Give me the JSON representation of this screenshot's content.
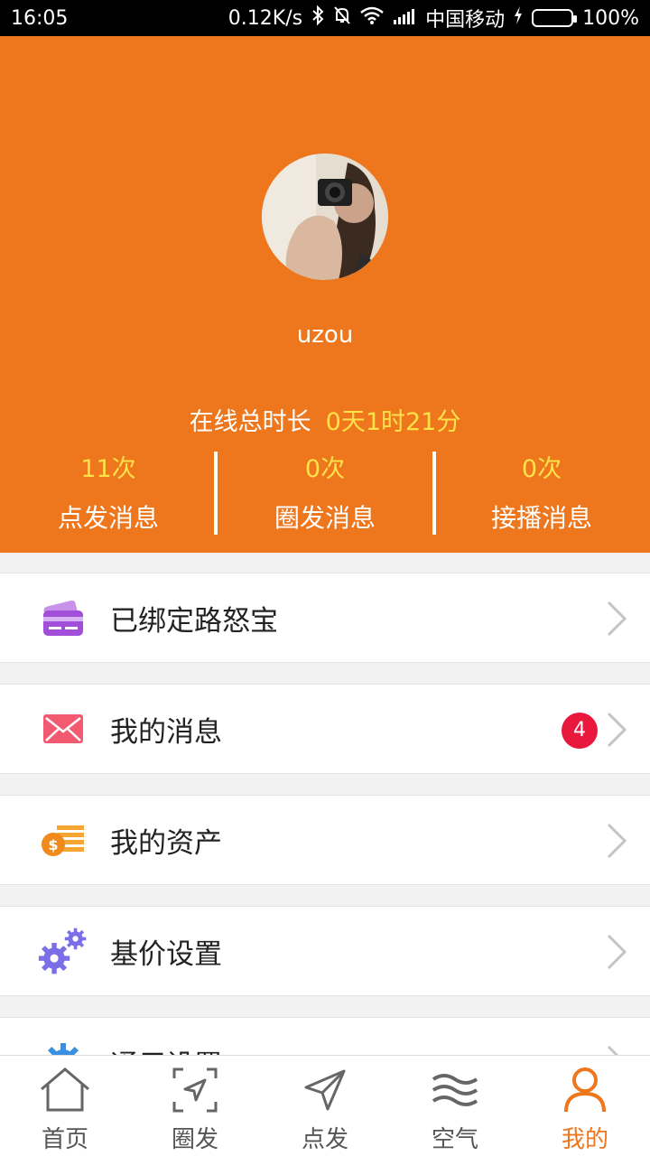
{
  "status_bar": {
    "time": "16:05",
    "speed": "0.12K/s",
    "carrier": "中国移动",
    "battery": "100%",
    "icons": [
      "bluetooth-icon",
      "mute-icon",
      "wifi-icon",
      "signal-icon",
      "charging-icon",
      "battery-icon"
    ]
  },
  "profile": {
    "username": "uzou",
    "online_label": "在线总时长",
    "online_value": "0天1时21分",
    "stats": [
      {
        "count": "11次",
        "label": "点发消息"
      },
      {
        "count": "0次",
        "label": "圈发消息"
      },
      {
        "count": "0次",
        "label": "接播消息"
      }
    ]
  },
  "menu": [
    {
      "label": "已绑定路怒宝",
      "icon": "card-icon"
    },
    {
      "label": "我的消息",
      "icon": "mail-icon",
      "badge": "4"
    },
    {
      "label": "我的资产",
      "icon": "coins-icon"
    },
    {
      "label": "基价设置",
      "icon": "gears-icon"
    },
    {
      "label": "通用设置",
      "icon": "settings-icon"
    }
  ],
  "nav": [
    {
      "label": "首页",
      "icon": "home-icon"
    },
    {
      "label": "圈发",
      "icon": "circle-send-icon"
    },
    {
      "label": "点发",
      "icon": "send-icon"
    },
    {
      "label": "空气",
      "icon": "air-icon"
    },
    {
      "label": "我的",
      "icon": "user-icon",
      "active": true
    }
  ],
  "colors": {
    "accent": "#ee761c",
    "highlight": "#ffe14a",
    "badge": "#e8193c"
  }
}
